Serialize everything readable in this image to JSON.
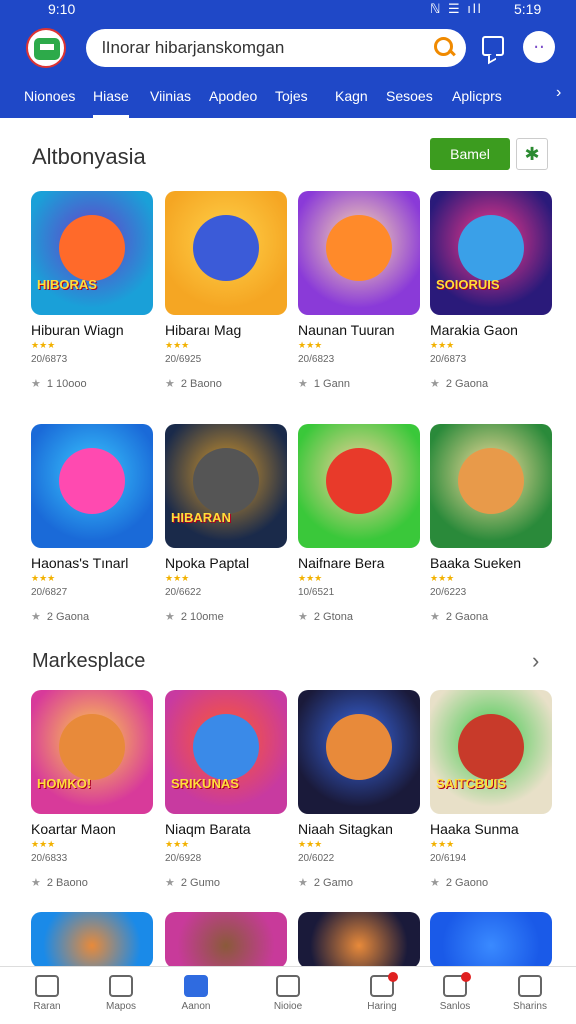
{
  "status": {
    "time_left": "9:10",
    "icons": "ℕ ☰ ıll",
    "time_right": "5:19"
  },
  "search": {
    "text": "lInorar hibarjanskomgan"
  },
  "tabs": [
    "Nionoes",
    "Hiase",
    "Viinias",
    "Apodeo",
    "Tojes",
    "Kagn",
    "Sesoes",
    "Aplicprs"
  ],
  "active_tab": 1,
  "section1": {
    "title": "Altbonyasia",
    "button": "Bamel"
  },
  "section2": {
    "title": "Markesplace"
  },
  "apps_row1": [
    {
      "name": "Hiburan Wiagn",
      "meta": "20/6873",
      "rating": "1",
      "count": "10ooo",
      "thumb_text": "HIBORAS",
      "colors": [
        "#1aa0d8",
        "#ff6a2a",
        "#6a3cc8"
      ]
    },
    {
      "name": "Hibaraı Mag",
      "meta": "20/6925",
      "rating": "2",
      "count": "Baono",
      "thumb_text": "",
      "colors": [
        "#f5a623",
        "#3b5bd8",
        "#ffd24a"
      ]
    },
    {
      "name": "Naunan Tuuran",
      "meta": "20/6823",
      "rating": "1",
      "count": "Gann",
      "thumb_text": "",
      "colors": [
        "#8a3ad8",
        "#ff8a2a",
        "#ffe0b0"
      ]
    },
    {
      "name": "Marakia Gaon",
      "meta": "20/6873",
      "rating": "2",
      "count": "Gaona",
      "thumb_text": "SOIORUIS",
      "colors": [
        "#2a1a7a",
        "#3aa0e8",
        "#ff3a8a"
      ]
    }
  ],
  "apps_row2": [
    {
      "name": "Haonas's Tınarl",
      "meta": "20/6827",
      "rating": "2",
      "count": "Gaona",
      "thumb_text": "",
      "colors": [
        "#1a6ad8",
        "#ff4ab0",
        "#3ac8ff"
      ]
    },
    {
      "name": "Npoka Paptal",
      "meta": "20/6622",
      "rating": "2",
      "count": "10ome",
      "thumb_text": "HIBARAN",
      "colors": [
        "#1a2a4a",
        "#555555",
        "#d89a2a"
      ]
    },
    {
      "name": "Naifnare Bera",
      "meta": "10/6521",
      "rating": "2",
      "count": "Gtona",
      "thumb_text": "",
      "colors": [
        "#3ac83a",
        "#e83a2a",
        "#ffd0a0"
      ]
    },
    {
      "name": "Baaka Sueken",
      "meta": "20/6223",
      "rating": "2",
      "count": "Gaona",
      "thumb_text": "",
      "colors": [
        "#2a8a3a",
        "#e89a4a",
        "#ffe0a0"
      ]
    }
  ],
  "apps_row3": [
    {
      "name": "Koartar Maon",
      "meta": "20/6833",
      "rating": "2",
      "count": "Baono",
      "thumb_text": "HOMKO!",
      "colors": [
        "#d83a9a",
        "#e88a3a",
        "#ffd24a"
      ]
    },
    {
      "name": "Niaqm Barata",
      "meta": "20/6928",
      "rating": "2",
      "count": "Gumo",
      "thumb_text": "SRIKUNAS",
      "colors": [
        "#c83aa0",
        "#3a8ae8",
        "#ff5a2a"
      ]
    },
    {
      "name": "Niaah Sitagkan",
      "meta": "20/6022",
      "rating": "2",
      "count": "Gamo",
      "thumb_text": "",
      "colors": [
        "#1a1a3a",
        "#e88a3a",
        "#3a6ae8"
      ]
    },
    {
      "name": "Haaka Sunma",
      "meta": "20/6194",
      "rating": "2",
      "count": "Gaono",
      "thumb_text": "SAITCBUIS",
      "colors": [
        "#e8e0c8",
        "#c83a2a",
        "#3ac84a"
      ]
    }
  ],
  "apps_row4_colors": [
    [
      "#1a8ae8",
      "#e88a3a"
    ],
    [
      "#c83a9a",
      "#8a5a3a"
    ],
    [
      "#1a1a3a",
      "#e88a3a"
    ],
    [
      "#1a5ae8",
      "#3a8aff"
    ]
  ],
  "bottom_nav": [
    "Raran",
    "Mapos",
    "Aanon",
    "Nioioe",
    "Haring",
    "Sanlos",
    "Sharins"
  ],
  "bottom_nav_active": 2
}
